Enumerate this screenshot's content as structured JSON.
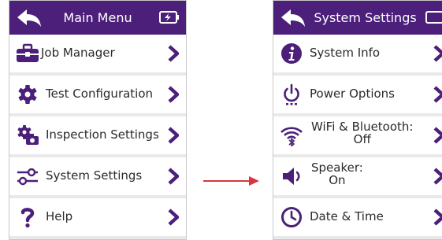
{
  "left_screen": {
    "title": "Main Menu",
    "items": [
      {
        "label": "Job Manager",
        "icon": "briefcase-icon"
      },
      {
        "label": "Test Configuration",
        "icon": "gear-icon"
      },
      {
        "label": "Inspection Settings",
        "icon": "gears-camera-icon"
      },
      {
        "label": "System Settings",
        "icon": "sliders-icon"
      },
      {
        "label": "Help",
        "icon": "question-icon"
      }
    ]
  },
  "right_screen": {
    "title": "System Settings",
    "items": [
      {
        "label": "System Info",
        "icon": "info-icon"
      },
      {
        "label": "Power Options",
        "icon": "power-icon"
      },
      {
        "label_line1": "WiFi & Bluetooth:",
        "label_line2": "Off",
        "icon": "wifi-bluetooth-icon"
      },
      {
        "label_line1": "Speaker:",
        "label_line2": "On",
        "icon": "speaker-icon"
      },
      {
        "label": "Date & Time",
        "icon": "clock-icon"
      }
    ]
  },
  "colors": {
    "header": "#4b1f7a",
    "accent": "#4b1f7a",
    "arrow": "#d9363e"
  }
}
